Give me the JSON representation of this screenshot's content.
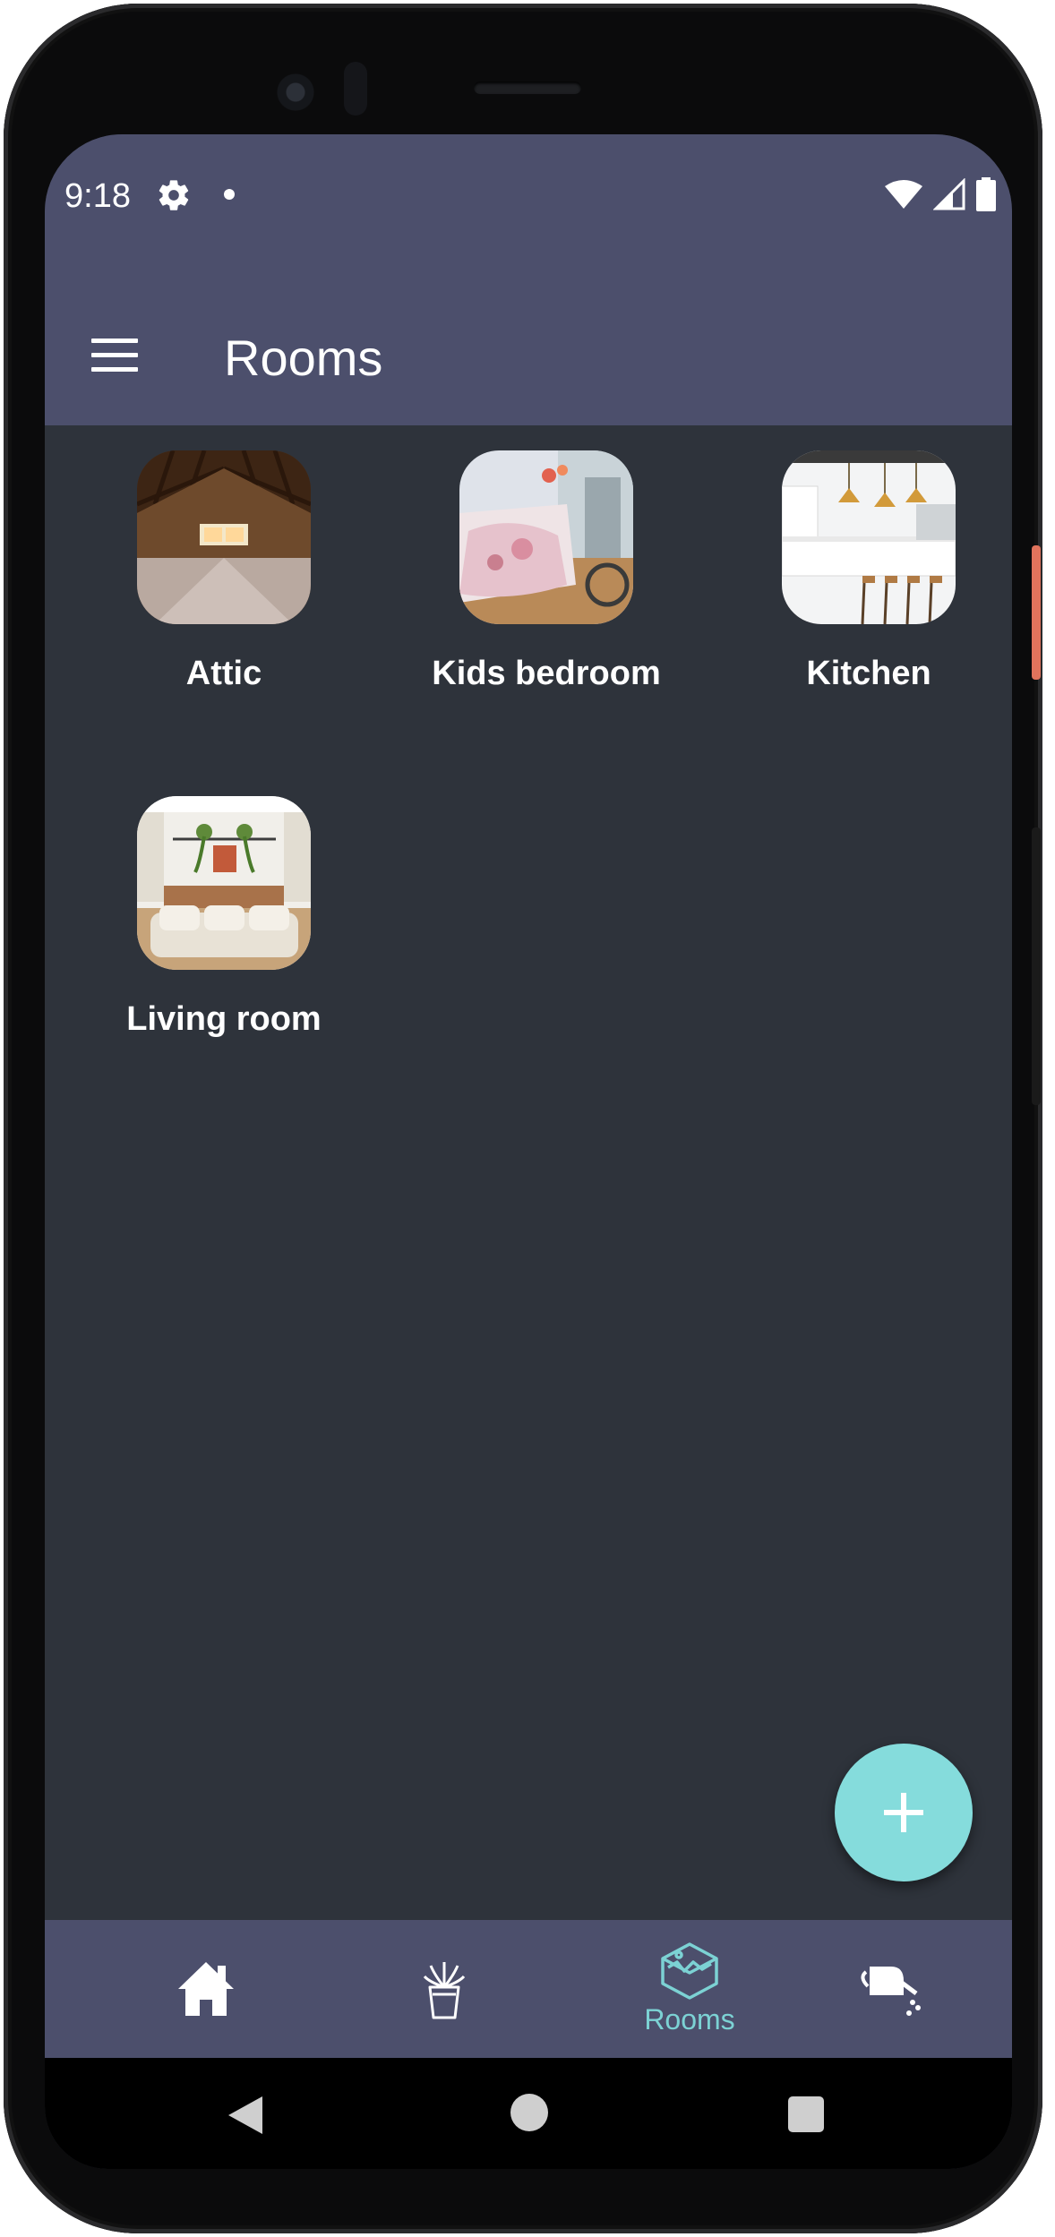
{
  "status_bar": {
    "time": "9:18",
    "icons": [
      "settings-gear-icon",
      "notification-dot",
      "wifi-icon",
      "signal-icon",
      "battery-icon"
    ]
  },
  "app_bar": {
    "menu_icon": "hamburger-menu-icon",
    "title": "Rooms"
  },
  "rooms": [
    {
      "label": "Attic",
      "image": "attic-photo"
    },
    {
      "label": "Kids bedroom",
      "image": "kids-bedroom-photo"
    },
    {
      "label": "Kitchen",
      "image": "kitchen-photo"
    },
    {
      "label": "Living room",
      "image": "living-room-photo"
    }
  ],
  "fab": {
    "icon": "plus-icon"
  },
  "bottom_nav": {
    "items": [
      {
        "icon": "home-icon",
        "label": ""
      },
      {
        "icon": "plant-icon",
        "label": ""
      },
      {
        "icon": "rooms-icon",
        "label": "Rooms",
        "active": true
      },
      {
        "icon": "watering-can-icon",
        "label": ""
      }
    ]
  },
  "system_nav": {
    "icons": [
      "back-icon",
      "home-circle-icon",
      "recents-icon"
    ]
  },
  "colors": {
    "app_bar": "#4c4f6c",
    "background": "#2e333b",
    "accent": "#85dcdc",
    "active_nav": "#7cd2d4",
    "text": "#ffffff"
  }
}
